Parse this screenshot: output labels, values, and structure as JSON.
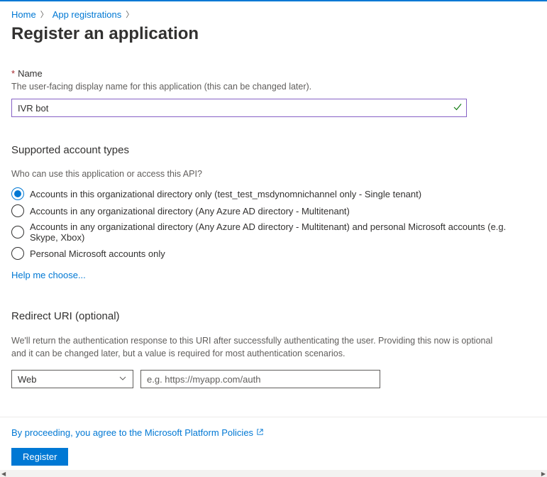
{
  "breadcrumb": {
    "home": "Home",
    "app_registrations": "App registrations"
  },
  "page_title": "Register an application",
  "name_section": {
    "label": "Name",
    "description": "The user-facing display name for this application (this can be changed later).",
    "value": "IVR bot"
  },
  "account_types": {
    "heading": "Supported account types",
    "question": "Who can use this application or access this API?",
    "options": [
      "Accounts in this organizational directory only (test_test_msdynomnichannel only - Single tenant)",
      "Accounts in any organizational directory (Any Azure AD directory - Multitenant)",
      "Accounts in any organizational directory (Any Azure AD directory - Multitenant) and personal Microsoft accounts (e.g. Skype, Xbox)",
      "Personal Microsoft accounts only"
    ],
    "selected_index": 0,
    "help_link": "Help me choose..."
  },
  "redirect": {
    "heading": "Redirect URI (optional)",
    "description": "We'll return the authentication response to this URI after successfully authenticating the user. Providing this now is optional and it can be changed later, but a value is required for most authentication scenarios.",
    "platform_selected": "Web",
    "uri_placeholder": "e.g. https://myapp.com/auth"
  },
  "footer": {
    "policies_text": "By proceeding, you agree to the Microsoft Platform Policies",
    "register_label": "Register"
  }
}
